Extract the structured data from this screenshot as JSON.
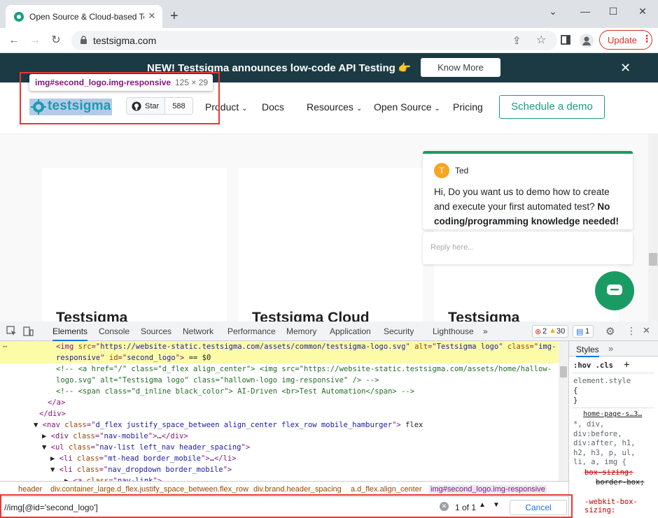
{
  "browser": {
    "tab_title": "Open Source & Cloud-based Test",
    "url": "testsigma.com",
    "update_label": "Update"
  },
  "site": {
    "banner_text": "NEW! Testsigma announces low-code API Testing 👉",
    "banner_button": "Know More",
    "logo_text": "testsigma",
    "github_star": "Star",
    "github_count": "588",
    "nav": {
      "product": "Product",
      "docs": "Docs",
      "resources": "Resources",
      "open_source": "Open Source",
      "pricing": "Pricing",
      "demo": "Schedule a demo"
    },
    "tooltip_selector": "img#second_logo.img-responsive",
    "tooltip_size": "125 × 29",
    "card_titles": [
      "Testsigma",
      "Testsigma Cloud",
      "Testsigma"
    ]
  },
  "chat": {
    "avatar_letter": "T",
    "agent_name": "Ted",
    "message": "Hi, Do you want us to demo how to create and execute your first automated test?",
    "message_bold": "No coding/programming knowledge needed!",
    "reply_placeholder": "Reply here..."
  },
  "devtools": {
    "tabs": [
      "Elements",
      "Console",
      "Sources",
      "Network",
      "Performance",
      "Memory",
      "Application",
      "Security",
      "Lighthouse"
    ],
    "more_tabs": "»",
    "errors": "2",
    "warnings": "30",
    "messages": "1",
    "code_lines": [
      {
        "parts": [
          [
            "tg",
            "<img "
          ],
          [
            "at",
            "src"
          ],
          [
            "tg",
            "=\""
          ],
          [
            "av",
            "https://website-static.testsigma.com/assets/common/testsigma-logo.svg"
          ],
          [
            "tg",
            "\" "
          ],
          [
            "at",
            "alt"
          ],
          [
            "tg",
            "=\""
          ],
          [
            "av",
            "Testsigma logo"
          ],
          [
            "tg",
            "\" "
          ],
          [
            "at",
            "class"
          ],
          [
            "tg",
            "=\""
          ],
          [
            "av",
            "img-"
          ]
        ]
      },
      {
        "parts": [
          [
            "av",
            "responsive"
          ],
          [
            "tg",
            "\" "
          ],
          [
            "at",
            "id"
          ],
          [
            "tg",
            "=\""
          ],
          [
            "av",
            "second_logo"
          ],
          [
            "tg",
            "\">"
          ],
          [
            "tx",
            " == $0"
          ]
        ]
      },
      {
        "parts": [
          [
            "cm",
            "<!-- <a href=\"/\" class=\"d_flex align_center\"> <img src=\"https://website-static.testsigma.com/assets/home/hallow-"
          ]
        ]
      },
      {
        "parts": [
          [
            "cm",
            "logo.svg\" alt=\"Testsigma logo\" class=\"hallown-logo img-responsive\" /> -->"
          ]
        ]
      },
      {
        "parts": [
          [
            "cm",
            "<!-- <span class=\"d_inline black_color\"> AI-Driven <br>Test Automation</span> -->"
          ]
        ]
      },
      {
        "parts": [
          [
            "tg",
            "</a>"
          ]
        ]
      },
      {
        "parts": [
          [
            "tg",
            "</div>"
          ]
        ]
      },
      {
        "parts": [
          [
            "tx",
            "▼ "
          ],
          [
            "tg",
            "<nav "
          ],
          [
            "at",
            "class"
          ],
          [
            "tg",
            "=\""
          ],
          [
            "av",
            "d_flex justify_space_between align_center flex_row mobile_hamburger"
          ],
          [
            "tg",
            "\">"
          ],
          [
            "tx",
            " flex"
          ]
        ]
      },
      {
        "parts": [
          [
            "tx",
            "▶ "
          ],
          [
            "tg",
            "<div "
          ],
          [
            "at",
            "class"
          ],
          [
            "tg",
            "=\""
          ],
          [
            "av",
            "nav-mobile"
          ],
          [
            "tg",
            "\">"
          ],
          [
            "tx",
            "…"
          ],
          [
            "tg",
            "</div>"
          ]
        ]
      },
      {
        "parts": [
          [
            "tx",
            "▼ "
          ],
          [
            "tg",
            "<ul "
          ],
          [
            "at",
            "class"
          ],
          [
            "tg",
            "=\""
          ],
          [
            "av",
            "nav-list left_nav header_spacing"
          ],
          [
            "tg",
            "\">"
          ]
        ]
      },
      {
        "parts": [
          [
            "tx",
            "▶ "
          ],
          [
            "tg",
            "<li "
          ],
          [
            "at",
            "class"
          ],
          [
            "tg",
            "=\""
          ],
          [
            "av",
            "mt-head border_mobile"
          ],
          [
            "tg",
            "\">"
          ],
          [
            "tx",
            "…"
          ],
          [
            "tg",
            "</li>"
          ]
        ]
      },
      {
        "parts": [
          [
            "tx",
            "▼ "
          ],
          [
            "tg",
            "<li "
          ],
          [
            "at",
            "class"
          ],
          [
            "tg",
            "=\""
          ],
          [
            "av",
            "nav_dropdown border_mobile"
          ],
          [
            "tg",
            "\">"
          ]
        ]
      },
      {
        "parts": [
          [
            "tx",
            "▶ "
          ],
          [
            "tg",
            "<a "
          ],
          [
            "at",
            "class"
          ],
          [
            "tg",
            "=\""
          ],
          [
            "av",
            "nav-link"
          ],
          [
            "tg",
            "\">"
          ]
        ]
      }
    ],
    "breadcrumbs": [
      "header",
      "div.container_large.d_flex.justify_space_between.flex_row",
      "div.brand.header_spacing",
      "a.d_flex.align_center",
      "img#second_logo.img-responsive"
    ],
    "search_query": "//img[@id='second_logo']",
    "search_result": "1 of 1",
    "cancel_label": "Cancel",
    "styles": {
      "tab": "Styles",
      "filter": ":hov .cls",
      "element_style": "element.style",
      "open_brace": "{",
      "close_brace": "}",
      "source": "home-page-s…3…",
      "selector": "*, div, div:before, div:after, h1, h2, h3, p, ul, li, a, img {",
      "prop1": "box-sizing:",
      "val1": "border-box;",
      "prop2": "-webkit-box-sizing:"
    }
  },
  "colors": {
    "accent_red": "#e53935",
    "brand_teal": "#1b9b84",
    "banner_bg": "#1b3a44",
    "chat_green": "#1b9b64"
  }
}
